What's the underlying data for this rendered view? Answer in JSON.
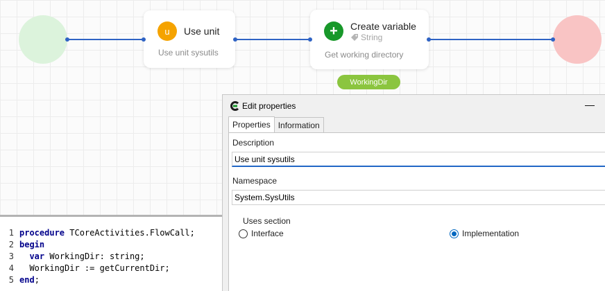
{
  "flow": {
    "use_unit_node": {
      "badge": "u",
      "title": "Use unit",
      "description": "Use unit sysutils"
    },
    "create_variable_node": {
      "badge": "+",
      "title": "Create variable",
      "type": "String",
      "description": "Get working directory",
      "variable": "WorkingDir"
    },
    "colors": {
      "wire": "#2f63c4",
      "start": "#dcf3dc",
      "end": "#f9c4c4",
      "use_unit_badge": "#f5a300",
      "create_badge": "#18982a",
      "variable_pill": "#8bc53f"
    }
  },
  "editor": {
    "lines": [
      {
        "num": "1",
        "kw": "procedure",
        "rest": " TCoreActivities.FlowCall;"
      },
      {
        "num": "2",
        "kw": "begin",
        "rest": ""
      },
      {
        "num": "3",
        "indent": "  ",
        "kw": "var",
        "rest": " WorkingDir: string;"
      },
      {
        "num": "4",
        "indent": "  ",
        "kw": "",
        "rest": "WorkingDir := getCurrentDir;"
      },
      {
        "num": "5",
        "kw": "end",
        "rest": ";"
      }
    ]
  },
  "properties": {
    "title": "Edit properties",
    "minimize": "—",
    "tabs": [
      {
        "label": "Properties",
        "active": true
      },
      {
        "label": "Information",
        "active": false
      }
    ],
    "description_label": "Description",
    "description_value": "Use unit sysutils",
    "namespace_label": "Namespace",
    "namespace_value": "System.SysUtils",
    "uses_section_label": "Uses section",
    "options": [
      {
        "label": "Interface",
        "checked": false
      },
      {
        "label": "Implementation",
        "checked": true
      }
    ],
    "accent": "#0067c0"
  }
}
